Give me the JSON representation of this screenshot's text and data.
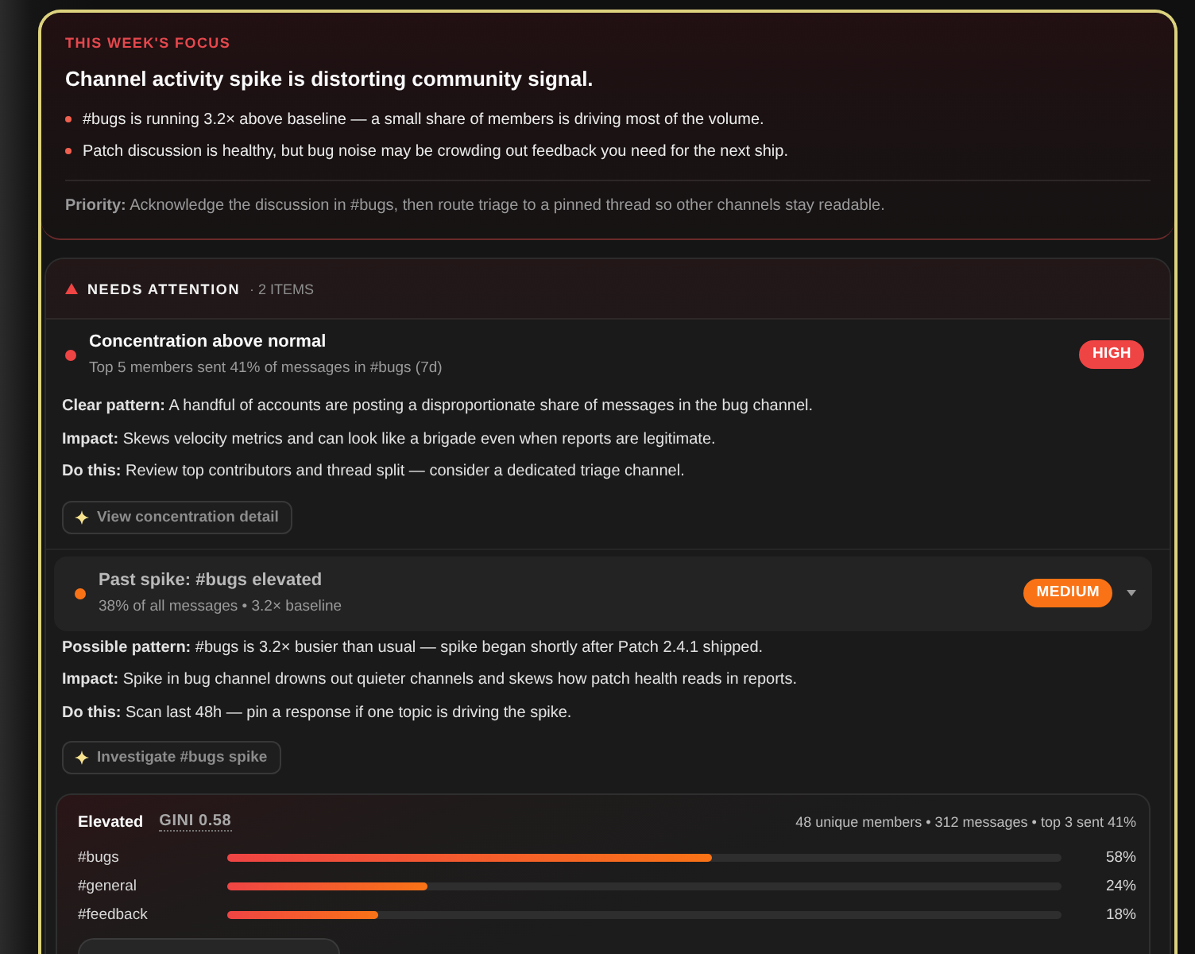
{
  "focus": {
    "eyebrow": "THIS WEEK'S FOCUS",
    "headline": "Channel activity spike is distorting community signal.",
    "bullets": [
      "#bugs is running 3.2× above baseline — a small share of members is driving most of the volume.",
      "Patch discussion is healthy, but bug noise may be crowding out feedback you need for the next ship."
    ],
    "priority": "**Priority:** Acknowledge the discussion in #bugs, then route triage to a pinned thread so other channels stay readable."
  },
  "attention": {
    "title": "NEEDS ATTENTION",
    "count": "· 2 ITEMS",
    "items": [
      {
        "kind": "current",
        "color": "#ef4444",
        "title": "Concentration above normal",
        "subtitle": "Top 5 members sent 41% of messages in #bugs (7d)",
        "severity": "HIGH",
        "details": [
          "**Clear pattern:** A handful of accounts are posting a disproportionate share of messages in the bug channel.",
          "**Impact:** Skews velocity metrics and can look like a brigade even when reports are legitimate.",
          "**Do this:** Review top contributors and thread split — consider a dedicated triage channel."
        ],
        "action": "View concentration detail"
      },
      {
        "kind": "past",
        "color": "#f97316",
        "title": "Past spike: #bugs elevated",
        "subtitle": "38% of all messages • 3.2× baseline",
        "severity": "MEDIUM",
        "details": [
          "**Possible pattern:** #bugs is 3.2× busier than usual — spike began shortly after Patch 2.4.1 shipped.",
          "**Impact:** Spike in bug channel drowns out quieter channels and skews how patch health reads in reports.",
          "**Do this:** Scan last 48h — pin a response if one topic is driving the spike."
        ],
        "action": "Investigate #bugs spike",
        "breakdown": {
          "status": "Elevated",
          "gini": "GINI 0.58",
          "summary": "48 unique members • 312 messages • top 3 sent 41%",
          "channels": [
            {
              "name": "#bugs",
              "level": 0.58,
              "reading": "58%"
            },
            {
              "name": "#general",
              "level": 0.24,
              "reading": "24%"
            },
            {
              "name": "#feedback",
              "level": 0.18,
              "reading": "18%"
            }
          ]
        }
      }
    ]
  }
}
